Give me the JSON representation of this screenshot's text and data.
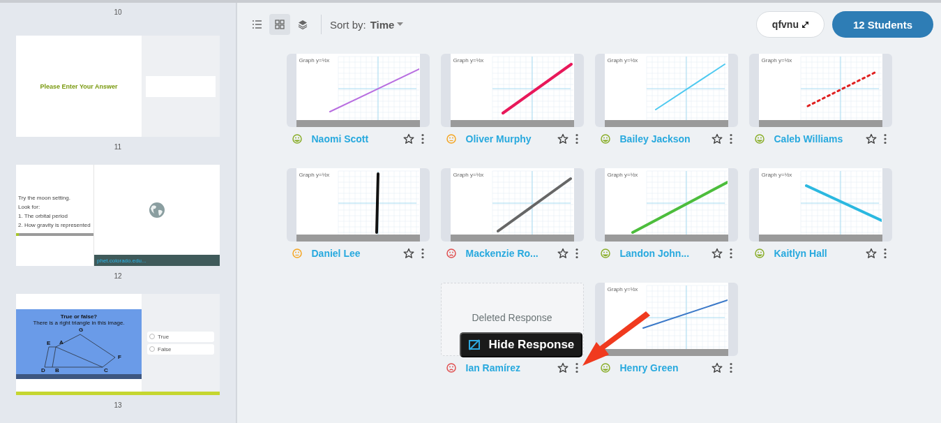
{
  "sidebar": {
    "top_number": "10",
    "slides": [
      {
        "kind": "answer_prompt",
        "number": "11",
        "prompt": "Please Enter Your Answer"
      },
      {
        "kind": "simulation",
        "number": "12",
        "lines": [
          "Try the moon setting.",
          "Look for:",
          "1. The orbital period",
          "2. How gravity is represented"
        ],
        "link": "phet.colorado.edu..."
      },
      {
        "kind": "true_false",
        "number": "13",
        "title": "True or false?",
        "question": "There is a right triangle in this image.",
        "diagram_labels": [
          "G",
          "E",
          "A",
          "F",
          "D",
          "B",
          "C"
        ],
        "options": [
          "True",
          "False"
        ]
      }
    ]
  },
  "toolbar": {
    "views": [
      {
        "kind": "list",
        "selected": false
      },
      {
        "kind": "grid",
        "selected": true
      },
      {
        "kind": "layers",
        "selected": false
      }
    ],
    "sort_label": "Sort by:",
    "sort_value": "Time",
    "code_button": "qfvnu",
    "students_button": "12 Students"
  },
  "responses": [
    {
      "kind": "graph",
      "name": "Naomi Scott",
      "face": {
        "kind": "happy",
        "color": "#8aae2a"
      },
      "title": "Graph",
      "equation": "y=½x",
      "line": {
        "kind": "thin",
        "color": "#b86ee0"
      }
    },
    {
      "kind": "graph",
      "name": "Oliver Murphy",
      "face": {
        "kind": "neutral",
        "color": "#f5a623"
      },
      "title": "Graph",
      "equation": "y=½x",
      "line": {
        "kind": "thick",
        "color": "#e8185a"
      }
    },
    {
      "kind": "graph",
      "name": "Bailey Jackson",
      "face": {
        "kind": "happy",
        "color": "#8aae2a"
      },
      "title": "Graph",
      "equation": "y=½x",
      "line": {
        "kind": "thin",
        "color": "#4dc9f0"
      }
    },
    {
      "kind": "graph",
      "name": "Caleb Williams",
      "face": {
        "kind": "happy",
        "color": "#8aae2a"
      },
      "title": "Graph",
      "equation": "y=½x",
      "line": {
        "kind": "dotted",
        "color": "#e02020"
      }
    },
    {
      "kind": "graph",
      "name": "Daniel Lee",
      "face": {
        "kind": "neutral",
        "color": "#f5a623"
      },
      "title": "Graph",
      "equation": "y=½x",
      "line": {
        "kind": "thick",
        "color": "#111111"
      }
    },
    {
      "kind": "graph",
      "name": "Mackenzie Ro...",
      "face": {
        "kind": "sad",
        "color": "#e05050"
      },
      "title": "Graph",
      "equation": "y=½x",
      "line": {
        "kind": "thick",
        "color": "#666666"
      }
    },
    {
      "kind": "graph",
      "name": "Landon John...",
      "face": {
        "kind": "happy",
        "color": "#8aae2a"
      },
      "title": "Graph",
      "equation": "y=½x",
      "line": {
        "kind": "thick",
        "color": "#4cbd3c"
      }
    },
    {
      "kind": "graph",
      "name": "Kaitlyn Hall",
      "face": {
        "kind": "happy",
        "color": "#8aae2a"
      },
      "title": "Graph",
      "equation": "y=½x",
      "line": {
        "kind": "thick",
        "color": "#2bb8e0"
      }
    },
    {
      "kind": "deleted",
      "name": "Ian Ramírez",
      "face": {
        "kind": "sad",
        "color": "#e05050"
      },
      "notice": "Deleted Response",
      "menu_tooltip": "Hide Response"
    },
    {
      "kind": "graph",
      "name": "Henry Green",
      "face": {
        "kind": "happy",
        "color": "#8aae2a"
      },
      "title": "Graph",
      "equation": "y=½x",
      "line": {
        "kind": "thin",
        "color": "#3a78c8"
      }
    }
  ]
}
